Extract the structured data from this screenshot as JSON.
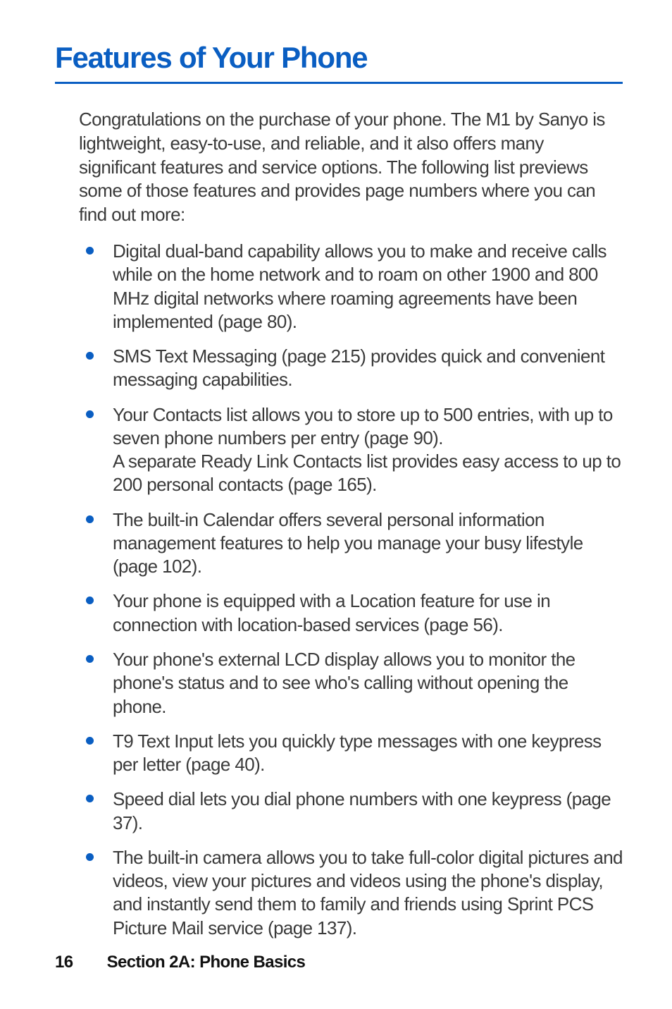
{
  "heading": "Features of Your Phone",
  "intro": "Congratulations on the purchase of your phone. The M1 by Sanyo is lightweight, easy-to-use, and reliable, and it also offers many significant features and service options. The following list previews some of those features and provides page numbers where you can find out more:",
  "bullets": [
    "Digital dual-band capability allows you to make and receive calls while on the home network and to roam on other 1900 and 800 MHz digital networks where roaming agreements have been implemented (page 80).",
    "SMS Text Messaging (page 215) provides quick and convenient messaging capabilities.",
    "Your Contacts list allows you to store up to 500 entries, with up to seven phone numbers per entry (page 90).\nA separate Ready Link Contacts list provides easy access to up to 200 personal contacts (page 165).",
    "The built-in Calendar offers several personal information management features to help you manage your busy lifestyle (page 102).",
    "Your phone is equipped with a Location feature for use in connection with location-based services (page 56).",
    "Your phone's external LCD display allows you to monitor the phone's status and to see who's calling without opening the phone.",
    "T9 Text Input lets you quickly type messages with one keypress per letter (page 40).",
    "Speed dial lets you dial phone numbers with one keypress (page 37).",
    "The built-in camera allows you to take full-color digital pictures and videos, view your pictures and videos using the phone's display, and instantly send them to family and friends using Sprint PCS Picture Mail service (page 137)."
  ],
  "footer": {
    "page_number": "16",
    "section_label": "Section 2A: Phone Basics"
  }
}
